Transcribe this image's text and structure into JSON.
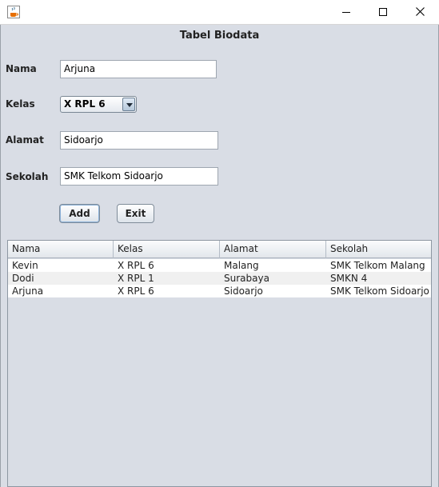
{
  "window": {
    "app_icon": "java-coffee-cup-icon",
    "controls": [
      "minimize-icon",
      "maximize-icon",
      "close-icon"
    ]
  },
  "form": {
    "title": "Tabel Biodata",
    "nama_label": "Nama",
    "nama_value": "Arjuna",
    "kelas_label": "Kelas",
    "kelas_value": "X RPL 6",
    "alamat_label": "Alamat",
    "alamat_value": "Sidoarjo",
    "sekolah_label": "Sekolah",
    "sekolah_value": "SMK Telkom Sidoarjo",
    "add_label": "Add",
    "exit_label": "Exit"
  },
  "table": {
    "columns": [
      "Nama",
      "Kelas",
      "Alamat",
      "Sekolah"
    ],
    "rows": [
      [
        "Kevin",
        "X RPL 6",
        "Malang",
        "SMK Telkom Malang"
      ],
      [
        "Dodi",
        "X RPL 1",
        "Surabaya",
        "SMKN 4"
      ],
      [
        "Arjuna",
        "X RPL 6",
        "Sidoarjo",
        "SMK Telkom Sidoarjo"
      ]
    ]
  },
  "colors": {
    "background": "#d9dde5",
    "row_alt": "#f0f0f0",
    "focus_ring": "#8ab0d8"
  }
}
